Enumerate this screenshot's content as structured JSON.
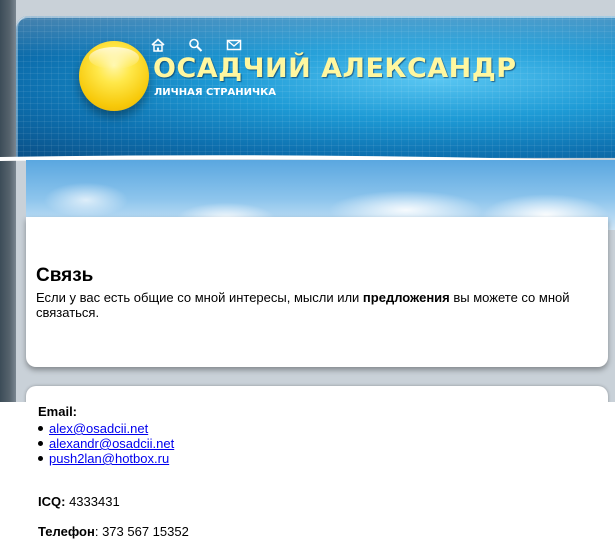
{
  "header": {
    "title": "ОСАДЧИЙ АЛЕКСАНДР",
    "subtitle": "ЛИЧНАЯ СТРАНИЧКА",
    "icons": [
      "home-icon",
      "search-icon",
      "mail-icon"
    ]
  },
  "section": {
    "title": "Связь",
    "text_before": "Если у вас есть общие со мной интересы, мысли или ",
    "text_bold": "предложения",
    "text_after": " вы можете со мной связаться."
  },
  "contacts": {
    "email_label": "Email:",
    "emails": [
      "alex@osadcii.net",
      "alexandr@osadcii.net",
      "push2lan@hotbox.ru"
    ],
    "icq_label": "ICQ:",
    "icq_value": "4333431",
    "phone_label": "Телефон",
    "phone_value": ": 373 567 15352"
  },
  "colors": {
    "title": "#fff7a0",
    "link": "#0000ee",
    "header_blue": "#1e9bd6"
  }
}
